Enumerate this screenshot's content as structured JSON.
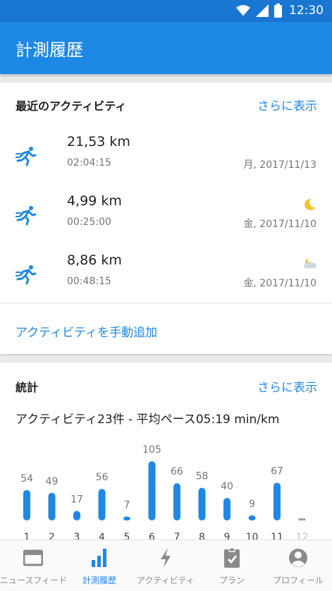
{
  "status": {
    "time": "12:30"
  },
  "appbar": {
    "title": "計測履歴"
  },
  "recent": {
    "heading": "最近のアクティビティ",
    "more": "さらに表示",
    "items": [
      {
        "distance": "21,53 km",
        "duration": "02:04:15",
        "date": "月, 2017/11/13",
        "weather": ""
      },
      {
        "distance": "4,99 km",
        "duration": "00:25:00",
        "date": "金, 2017/11/10",
        "weather": "moon-icon"
      },
      {
        "distance": "8,86 km",
        "duration": "00:48:15",
        "date": "金, 2017/11/10",
        "weather": "cloud-moon-icon"
      }
    ],
    "add_link": "アクティビティを手動追加"
  },
  "stats": {
    "heading": "統計",
    "more": "さらに表示",
    "summary": "アクティビティ23件 - 平均ペース05:19 min/km"
  },
  "chart_data": {
    "type": "bar",
    "categories": [
      "1",
      "2",
      "3",
      "4",
      "5",
      "6",
      "7",
      "8",
      "9",
      "10",
      "11",
      "12"
    ],
    "values": [
      54,
      49,
      17,
      56,
      7,
      105,
      66,
      58,
      40,
      9,
      67,
      0
    ],
    "data_labels": [
      "54",
      "49",
      "17",
      "56",
      "7",
      "105",
      "66",
      "58",
      "40",
      "9",
      "67",
      ""
    ],
    "title": "",
    "xlabel": "",
    "ylabel": "",
    "ylim": [
      0,
      105
    ],
    "bar_color": "#1e88e5",
    "future_color": "#9e9e9e"
  },
  "nav": {
    "items": [
      {
        "label": "ニュースフィード",
        "icon": "newsfeed-icon",
        "active": false
      },
      {
        "label": "計測履歴",
        "icon": "bar-chart-icon",
        "active": true
      },
      {
        "label": "アクティビティ",
        "icon": "lightning-icon",
        "active": false
      },
      {
        "label": "プラン",
        "icon": "clipboard-icon",
        "active": false
      },
      {
        "label": "プロフィール",
        "icon": "profile-icon",
        "active": false
      }
    ]
  },
  "colors": {
    "primary": "#1e88e5",
    "status_bar": "#1976d2",
    "moon": "#fbc02d"
  }
}
